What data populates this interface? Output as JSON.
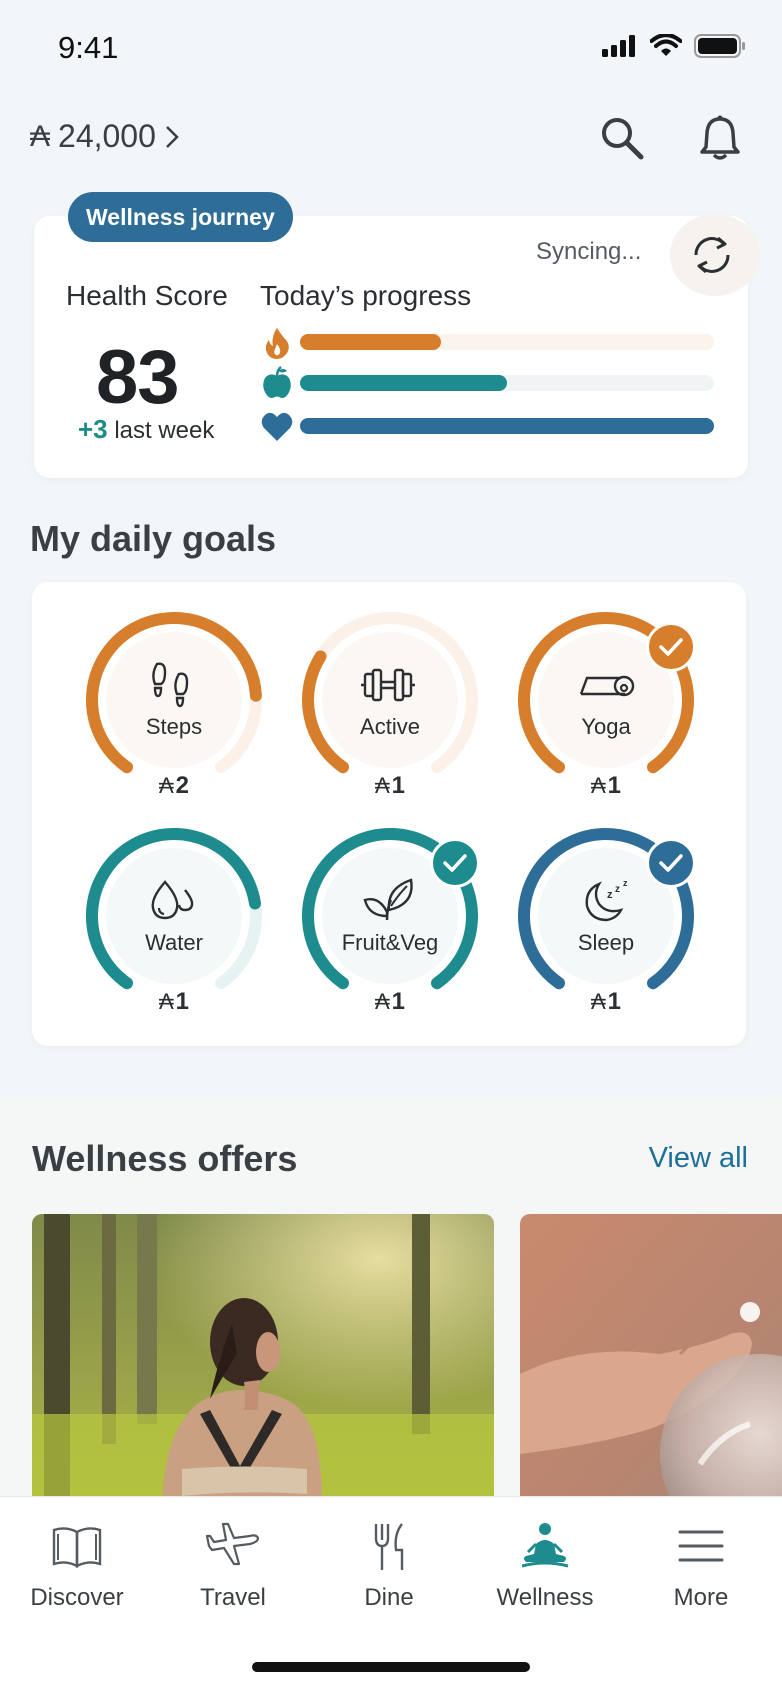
{
  "status_bar": {
    "time": "9:41"
  },
  "header": {
    "points_symbol": "₳",
    "points": "24,000",
    "search_icon": "search-icon",
    "notification_icon": "bell-icon"
  },
  "health_card": {
    "badge": "Wellness journey",
    "sync_status": "Syncing...",
    "health_score_label": "Health Score",
    "score": "83",
    "delta": "+3",
    "delta_suffix": "last week",
    "progress_label": "Today’s progress",
    "progress": [
      {
        "icon": "flame-icon",
        "value": 0.34,
        "color": "#d67e2b",
        "track": "#fbf3ec"
      },
      {
        "icon": "apple-icon",
        "value": 0.5,
        "color": "#1e8b8e",
        "track": "#eef5f4"
      },
      {
        "icon": "heart-icon",
        "value": 1.0,
        "color": "#2f6d99",
        "track": "#e9f0f5"
      }
    ]
  },
  "daily_goals": {
    "title": "My daily goals",
    "items": [
      {
        "label": "Steps",
        "reward": "2",
        "icon": "footsteps-icon",
        "progress": 0.8,
        "color": "#d67e2b",
        "track": "#fbf1e8",
        "done": false
      },
      {
        "label": "Active",
        "reward": "1",
        "icon": "dumbbell-icon",
        "progress": 0.3,
        "color": "#d67e2b",
        "track": "#fbf1e8",
        "done": false
      },
      {
        "label": "Yoga",
        "reward": "1",
        "icon": "yoga-mat-icon",
        "progress": 1.0,
        "color": "#d67e2b",
        "track": "#fbf1e8",
        "done": true
      },
      {
        "label": "Water",
        "reward": "1",
        "icon": "water-drops-icon",
        "progress": 0.78,
        "color": "#1e8b8e",
        "track": "#e7f3f2",
        "done": false
      },
      {
        "label": "Fruit&Veg",
        "reward": "1",
        "icon": "leaves-icon",
        "progress": 1.0,
        "color": "#1e8b8e",
        "track": "#e7f3f2",
        "done": true
      },
      {
        "label": "Sleep",
        "reward": "1",
        "icon": "moon-sleep-icon",
        "progress": 1.0,
        "color": "#2f6d99",
        "track": "#e7eff5",
        "done": true
      }
    ],
    "reward_symbol": "₳"
  },
  "offers": {
    "title": "Wellness offers",
    "view_all": "View all",
    "cards": [
      {
        "image": "woman-stretching-in-park-photo"
      },
      {
        "image": "hand-with-glass-ball-photo"
      }
    ]
  },
  "nav": {
    "items": [
      {
        "label": "Discover",
        "icon": "book-icon",
        "active": false
      },
      {
        "label": "Travel",
        "icon": "plane-icon",
        "active": false
      },
      {
        "label": "Dine",
        "icon": "fork-knife-icon",
        "active": false
      },
      {
        "label": "Wellness",
        "icon": "meditation-icon",
        "active": true
      },
      {
        "label": "More",
        "icon": "menu-icon",
        "active": false
      }
    ]
  },
  "colors": {
    "accent_blue": "#2f6d99",
    "accent_teal": "#1e8b8e",
    "accent_orange": "#d67e2b",
    "link": "#1e6f9b"
  }
}
